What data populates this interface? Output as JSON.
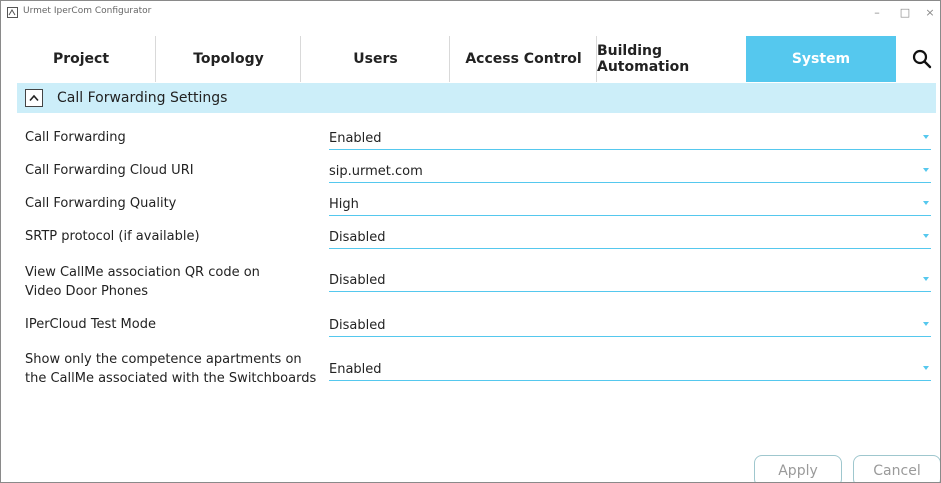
{
  "window": {
    "title": "Urmet IperCom Configurator",
    "minimize_icon": "minimize-icon",
    "maximize_icon": "maximize-icon",
    "close_icon": "close-icon"
  },
  "tabs": [
    {
      "label": "Project",
      "active": false
    },
    {
      "label": "Topology",
      "active": false
    },
    {
      "label": "Users",
      "active": false
    },
    {
      "label": "Access Control",
      "active": false
    },
    {
      "label": "Building Automation",
      "active": false
    },
    {
      "label": "System",
      "active": true
    }
  ],
  "search_icon": "search-icon",
  "section": {
    "title": "Call Forwarding Settings",
    "collapse_icon": "chevron-up-icon"
  },
  "settings": [
    {
      "label": "Call Forwarding",
      "value": "Enabled"
    },
    {
      "label": "Call Forwarding Cloud URI",
      "value": "sip.urmet.com"
    },
    {
      "label": "Call Forwarding Quality",
      "value": "High"
    },
    {
      "label": "SRTP protocol (if available)",
      "value": "Disabled"
    },
    {
      "label": "View CallMe association QR code on Video Door Phones",
      "value": "Disabled"
    },
    {
      "label": "IPerCloud Test Mode",
      "value": "Disabled"
    },
    {
      "label": "Show only the competence apartments on the CallMe associated with the Switchboards",
      "value": "Enabled"
    }
  ],
  "buttons": {
    "apply": "Apply",
    "cancel": "Cancel"
  },
  "colors": {
    "accent": "#55c8ee",
    "section_bg": "#cceef9"
  }
}
